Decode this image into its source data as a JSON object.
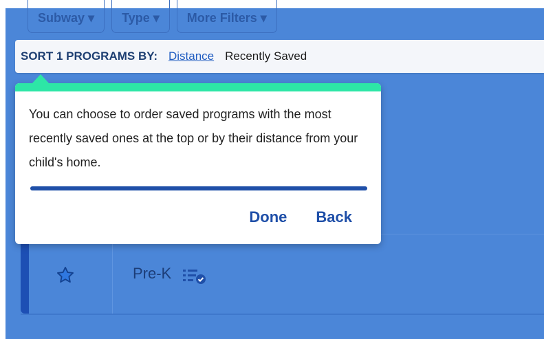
{
  "filters": [
    {
      "label": "Subway ▾"
    },
    {
      "label": "Type ▾"
    },
    {
      "label": "More Filters ▾"
    }
  ],
  "sort_bar": {
    "label": "SORT 1 PROGRAMS BY:",
    "option_distance": "Distance",
    "option_recent": "Recently Saved"
  },
  "popover": {
    "text": "You can choose to order saved programs with the most recently saved ones at the top or by their distance from your child's home.",
    "progress_fraction": 1.0,
    "done_label": "Done",
    "back_label": "Back",
    "accent_color": "#2de6a6",
    "progress_color": "#1f4fa8"
  },
  "program_row": {
    "star_icon": "star-icon",
    "label": "Pre-K",
    "badge_icon": "list-check-icon"
  },
  "colors": {
    "background_blue": "#4b86d8",
    "row_accent": "#1d4fb4"
  }
}
